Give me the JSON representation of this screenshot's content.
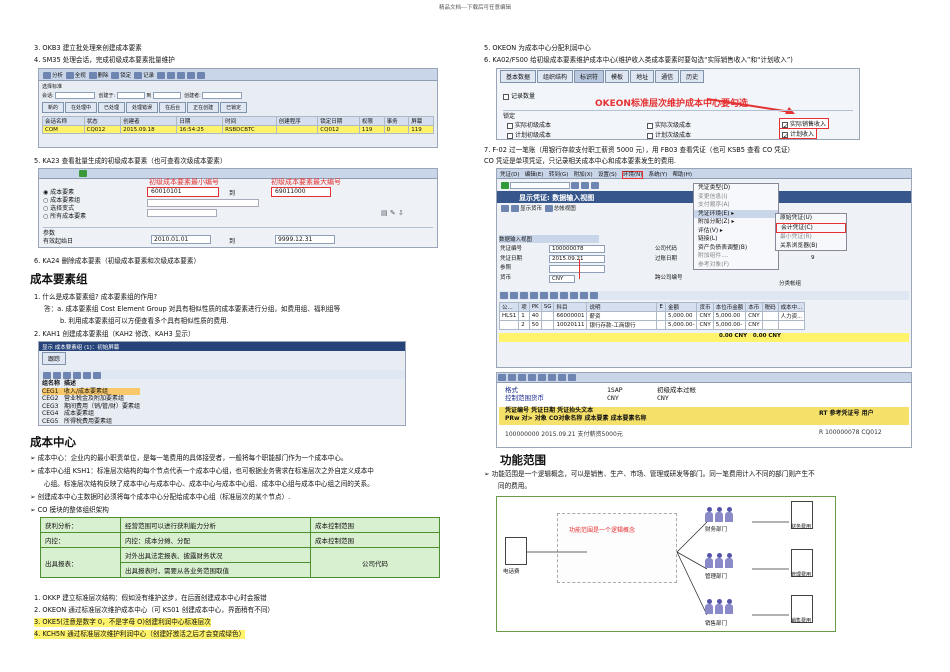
{
  "header": "精品文档---下载后可任意编辑",
  "left": {
    "steps_top": [
      "3.  OKB3 建立批处理来创建成本要素",
      "4.  SM35 处理会话，完成初级成本要素批量维护",
      "5.  KA23 查看批量生成的初级成本要素（也可查看次级成本要素）",
      "6.  KA24 删除成本要素（初级成本要素和次级成本要素）"
    ],
    "sm35": {
      "toolbar": [
        "分析",
        "全视",
        "删除",
        "锁定",
        "记录"
      ],
      "select_label": "选择标准",
      "fields": [
        "会话:",
        "创建于:",
        "从",
        "到",
        "创建者:"
      ],
      "field_vals": [
        "*",
        "",
        "",
        "",
        "*"
      ],
      "tabs": [
        "新的",
        "在处理中",
        "已处理",
        "处理错误",
        "在后台",
        "正在创建",
        "已锁定"
      ],
      "cols": [
        "会话名称",
        "状态",
        "创建者",
        "日期",
        "时间",
        "创建程序",
        "锁定日期",
        "权限",
        "事务",
        "屏幕"
      ],
      "row": [
        "COM",
        "CQ012",
        "2015.09.18",
        "16:54:25",
        "RSBDCBTC",
        "",
        "CQ012",
        "119",
        "0",
        "119"
      ]
    },
    "ka23": {
      "annot_min": "初级成本要素最小编号",
      "annot_max": "初级成本要素最大编号",
      "radio": [
        "成本要素",
        "成本要素组",
        "选择变式",
        "所有成本要素"
      ],
      "from": "60010101",
      "to_label": "到",
      "to": "69011000",
      "param_label": "参数",
      "valid_label": "有效起始日",
      "valid_from": "2010.01.01",
      "valid_to": "9999.12.31"
    },
    "group_title": "成本要素组",
    "group_q": "1.  什么是成本要素组? 成本要素组的作用?",
    "group_a1": "答：a. 成本要素组 Cost Element Group 对具有相似性质的成本要素进行分组，如费用组、福利组等",
    "group_a2": "b. 利用成本要素组可以方便查看多个具有相似性质的费用.",
    "group_step2": "2.  KAH1 创建成本要素组（KAH2 修改、KAH3 显示）",
    "kah1": {
      "title": "显示 成本要素组 (1)：初始屏幕",
      "tab": "跟踪",
      "cols": [
        "组名称",
        "描述"
      ],
      "rows": [
        [
          "CEG1",
          "收入/成本要素组"
        ],
        [
          "CEG2",
          "营业税金及附加要素组"
        ],
        [
          "CEG3",
          "期间费用（销/管/财）要素组"
        ],
        [
          "CEG4",
          "成本要素组"
        ],
        [
          "CEG5",
          "所得税费用要素组"
        ]
      ]
    },
    "center_title": "成本中心",
    "center_bullets": [
      "成本中心：企业内的最小职责单位，是每一笔费用的具体接受者，一般将每个职能部门作为一个成本中心。",
      "成本中心组 KSH1：标准层次结构的每个节点代表一个成本中心组，也可根据业务需求在标准层次之外自定义成本中",
      "心组。标准层次结构反映了成本中心与成本中心、成本中心与成本中心组、成本中心组与成本中心组之间的关系。",
      "创建成本中心主数据时必须将每个成本中心分配给成本中心组（标准层次的某个节点）.",
      "CO 模块的整体组织架构"
    ],
    "org_table": [
      [
        "获利分析：",
        "经营范围可以进行获利能力分析",
        "成本控制范围"
      ],
      [
        "内控：",
        "内控：成本分摊、分配",
        "成本控制范围"
      ],
      [
        "出具报表：",
        "对外出具法定报表、披露财务状况",
        "公司代码"
      ],
      [
        "",
        "出具报表时，需要从各业务范围取值",
        ""
      ]
    ],
    "center_steps": [
      "1.  OKKP 建立标准层次结构：假如没有维护这步，在后面创建成本中心时会报错",
      "2.  OKEON 通过标准层次维护成本中心（可 KS01 创建成本中心，界面稍有不同）",
      "3.  OKE5(注意是数字 0，不是字母 O)创建利润中心标准层次",
      "4.  KCH5N 通过标准层次维护利润中心（创建好激活之后才会变成绿色）"
    ]
  },
  "right": {
    "steps_top": [
      "5.  OKEON 为成本中心分配利润中心",
      "6.  KA02/FS00 给初级成本要素维护成本中心(维护收入类成本要素时要勾选“实际销售收入”和“计划收入”)"
    ],
    "okeon": {
      "tabs": [
        "基本数据",
        "组织结构",
        "标识符",
        "模板",
        "地址",
        "通信",
        "历史"
      ],
      "record_qty": "记录数量",
      "annot": "OKEON标准层次维护成本中心要勾选",
      "lock_label": "锁定",
      "checks": [
        "实际初级成本",
        "实际次级成本",
        "实际销售收入",
        "计划初级成本",
        "计划次级成本",
        "计划收入"
      ]
    },
    "fb03_text1": "7.  F-02 过一笔账（用银行存款支付职工薪资 5000 元），用 FB03 查看凭证（也可 KSB5 查看 CO 凭证）",
    "fb03_text2": "CO 凭证是单项凭证，只记录相关成本中心和成本要素发生的费用.",
    "fb03": {
      "menu": [
        "凭证(D)",
        "编辑(E)",
        "转到(G)",
        "附加(X)",
        "设置(S)",
        "环境(N)",
        "系统(Y)",
        "帮助(H)"
      ],
      "title": "显示凭证: 数据输入视图",
      "sub_tools": [
        "显示货币",
        "总帐视图"
      ],
      "dd1": [
        "凭证类型(D)",
        "变更信息(I)",
        "支付顺序(A)",
        "凭证环境(E)",
        "附加分配(Z)",
        "评估(V)",
        "链接(L)",
        "资产负债表调整(B)",
        "附加组件....",
        "参考对象(F)"
      ],
      "dd2": [
        "原始凭证(U)",
        "会计凭证(C)",
        "最小凭证(R)",
        "关系浏览器(B)"
      ],
      "view_label": "数据输入视图",
      "doc_no_label": "凭证编号",
      "doc_no": "100000078",
      "doc_date_label": "凭证日期",
      "doc_date": "2015.09.21",
      "ref_label": "参照",
      "curr_label": "货币",
      "curr": "CNY",
      "co_label": "公司代码",
      "post_label": "过账日期",
      "cross_label": "跨公司编号",
      "ledger_label": "分类帐组",
      "year": "015",
      "period": "9",
      "cols": [
        "公... ",
        "项",
        "PK",
        "SG",
        "科目",
        "说明",
        "E",
        "金额",
        "货币",
        "本位币金额",
        "本币",
        "税码",
        "成本中..."
      ],
      "rows": [
        [
          "HLS1",
          "1",
          "40",
          "",
          "66000001",
          "薪资",
          "",
          "5,000.00",
          "CNY",
          "5,000.00",
          "CNY",
          "",
          "人力资..."
        ],
        [
          "",
          "2",
          "50",
          "",
          "10020111",
          "银行存款-工商银行",
          "",
          "5,000.00-",
          "CNY",
          "5,000.00-",
          "CNY",
          "",
          ""
        ]
      ],
      "sum": [
        "0.00",
        "CNY",
        "0.00",
        "CNY"
      ],
      "co_fmt": "格式",
      "co_fmt_val": "1SAP",
      "co_fmt_txt": "初级成本过帐",
      "co_cur": "控制范围货币",
      "co_cur_val": "CNY",
      "co_cur_txt": "CNY",
      "co_cols": "凭证编号  凭证日期  凭证抬头文本",
      "co_cols2": "PRw 对> 对象       CO对象名称          成本要素  成本要素名称",
      "co_cols_r": "RT 参考凭证号 用户",
      "co_row": "100000000  2015.09.21  支付薪资5000元",
      "co_row_r": "R  100000078  CQ012"
    },
    "func_title": "功能范围",
    "func_text1": "功能范围是一个逻辑概念，可以是销售、生产、市场、管理或研发等部门。同一笔费用计入不同的部门则产生不",
    "func_text2": "同的费用。",
    "func_diagram": {
      "center": "功能范围是一个逻辑概念",
      "left_doc": "电话费",
      "depts": [
        "财务部门",
        "管理部门",
        "销售部门"
      ],
      "docs": [
        "财务费用",
        "管理费用",
        "销售费用"
      ]
    }
  }
}
